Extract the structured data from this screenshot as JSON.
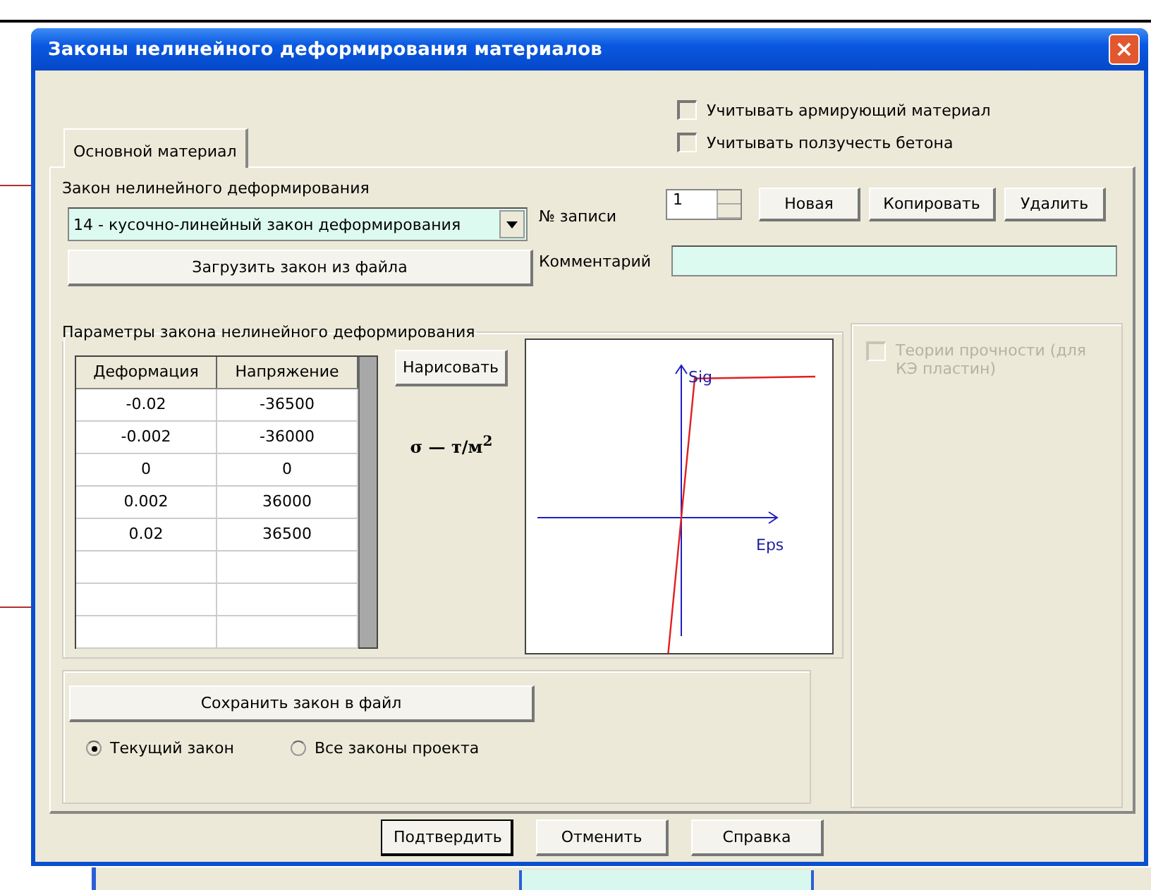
{
  "window": {
    "title": "Законы нелинейного деформирования материалов",
    "close": "×"
  },
  "options": [
    {
      "label": "Учитывать армирующий материал",
      "checked": false
    },
    {
      "label": "Учитывать ползучесть бетона",
      "checked": false
    }
  ],
  "tabs": [
    {
      "label": "Основной материал",
      "selected": true
    }
  ],
  "law": {
    "label": "Закон нелинейного деформирования",
    "value": "14 - кусочно-линейный закон деформирования",
    "load_button": "Загрузить закон из файла"
  },
  "record": {
    "label": "№ записи",
    "value": "1",
    "buttons": [
      "Новая",
      "Копировать",
      "Удалить"
    ]
  },
  "comment": {
    "label": "Комментарий"
  },
  "params": {
    "title": "Параметры закона нелинейного деформирования",
    "columns": [
      "Деформация",
      "Напряжение"
    ],
    "rows": [
      [
        "-0.02",
        "-36500"
      ],
      [
        "-0.002",
        "-36000"
      ],
      [
        "0",
        "0"
      ],
      [
        "0.002",
        "36000"
      ],
      [
        "0.02",
        "36500"
      ]
    ],
    "draw_button": "Нарисовать",
    "units": "σ — т/м$^{2}$",
    "y_axis": "Sig",
    "x_axis": "Eps"
  },
  "strength": {
    "label": "Теории прочности (для КЭ пластин)",
    "checked": false,
    "disabled": true
  },
  "save": {
    "button": "Сохранить закон в файл",
    "modes": [
      {
        "label": "Текущий закон",
        "selected": true
      },
      {
        "label": "Все законы проекта",
        "selected": false
      }
    ]
  },
  "dialog_buttons": [
    "Подтвердить",
    "Отменить",
    "Справка"
  ]
}
